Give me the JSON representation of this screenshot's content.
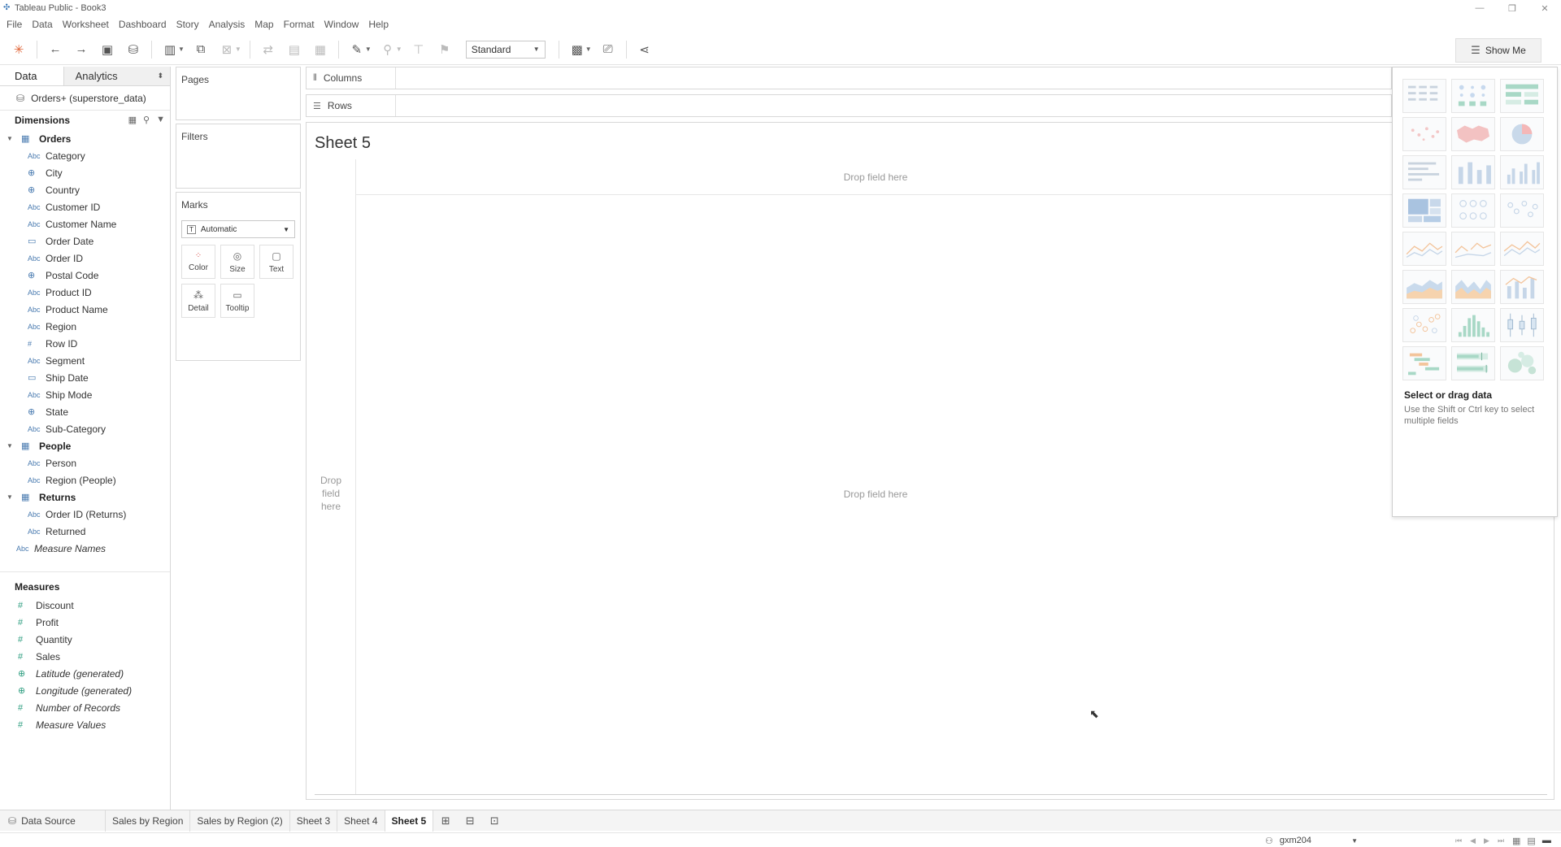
{
  "window": {
    "title": "Tableau Public - Book3"
  },
  "menu": [
    "File",
    "Data",
    "Worksheet",
    "Dashboard",
    "Story",
    "Analysis",
    "Map",
    "Format",
    "Window",
    "Help"
  ],
  "toolbar": {
    "fit_value": "Standard",
    "show_me_label": "Show Me"
  },
  "data_pane": {
    "tabs": {
      "data": "Data",
      "analytics": "Analytics"
    },
    "datasource": "Orders+ (superstore_data)",
    "dimensions_label": "Dimensions",
    "orders": {
      "name": "Orders",
      "fields": [
        {
          "type": "Abc",
          "name": "Category"
        },
        {
          "type": "geo",
          "name": "City"
        },
        {
          "type": "geo",
          "name": "Country"
        },
        {
          "type": "Abc",
          "name": "Customer ID"
        },
        {
          "type": "Abc",
          "name": "Customer Name"
        },
        {
          "type": "date",
          "name": "Order Date"
        },
        {
          "type": "Abc",
          "name": "Order ID"
        },
        {
          "type": "geo",
          "name": "Postal Code"
        },
        {
          "type": "Abc",
          "name": "Product ID"
        },
        {
          "type": "Abc",
          "name": "Product Name"
        },
        {
          "type": "Abc",
          "name": "Region"
        },
        {
          "type": "#",
          "name": "Row ID"
        },
        {
          "type": "Abc",
          "name": "Segment"
        },
        {
          "type": "date",
          "name": "Ship Date"
        },
        {
          "type": "Abc",
          "name": "Ship Mode"
        },
        {
          "type": "geo",
          "name": "State"
        },
        {
          "type": "Abc",
          "name": "Sub-Category"
        }
      ]
    },
    "people": {
      "name": "People",
      "fields": [
        {
          "type": "Abc",
          "name": "Person"
        },
        {
          "type": "Abc",
          "name": "Region (People)"
        }
      ]
    },
    "returns": {
      "name": "Returns",
      "fields": [
        {
          "type": "Abc",
          "name": "Order ID (Returns)"
        },
        {
          "type": "Abc",
          "name": "Returned"
        }
      ]
    },
    "measure_names": "Measure Names",
    "measures_label": "Measures",
    "measures": [
      {
        "type": "#",
        "name": "Discount",
        "italic": false
      },
      {
        "type": "#",
        "name": "Profit",
        "italic": false
      },
      {
        "type": "#",
        "name": "Quantity",
        "italic": false
      },
      {
        "type": "#",
        "name": "Sales",
        "italic": false
      },
      {
        "type": "geo",
        "name": "Latitude (generated)",
        "italic": true
      },
      {
        "type": "geo",
        "name": "Longitude (generated)",
        "italic": true
      },
      {
        "type": "#",
        "name": "Number of Records",
        "italic": true
      },
      {
        "type": "#",
        "name": "Measure Values",
        "italic": true
      }
    ]
  },
  "cards": {
    "pages": "Pages",
    "filters": "Filters",
    "marks": "Marks",
    "marks_type": "Automatic",
    "mark_buttons": {
      "color": "Color",
      "size": "Size",
      "text": "Text",
      "detail": "Detail",
      "tooltip": "Tooltip"
    }
  },
  "shelves": {
    "columns": "Columns",
    "rows": "Rows"
  },
  "view": {
    "sheet_title": "Sheet 5",
    "drop_top": "Drop field here",
    "drop_left": "Drop field here",
    "drop_center": "Drop field here"
  },
  "show_me": {
    "hint_title": "Select or drag data",
    "hint_text": "Use the Shift or Ctrl key to select multiple fields"
  },
  "sheet_tabs": {
    "data_source": "Data Source",
    "tabs": [
      "Sales by Region",
      "Sales by Region (2)",
      "Sheet 3",
      "Sheet 4",
      "Sheet 5"
    ],
    "active": "Sheet 5"
  },
  "status": {
    "user": "gxm204"
  },
  "colors": {
    "dimension_icon": "#4a7bb0",
    "measure_icon": "#2e9e80",
    "accent_orange": "#f0a45a",
    "accent_blue": "#5b8fc9"
  }
}
